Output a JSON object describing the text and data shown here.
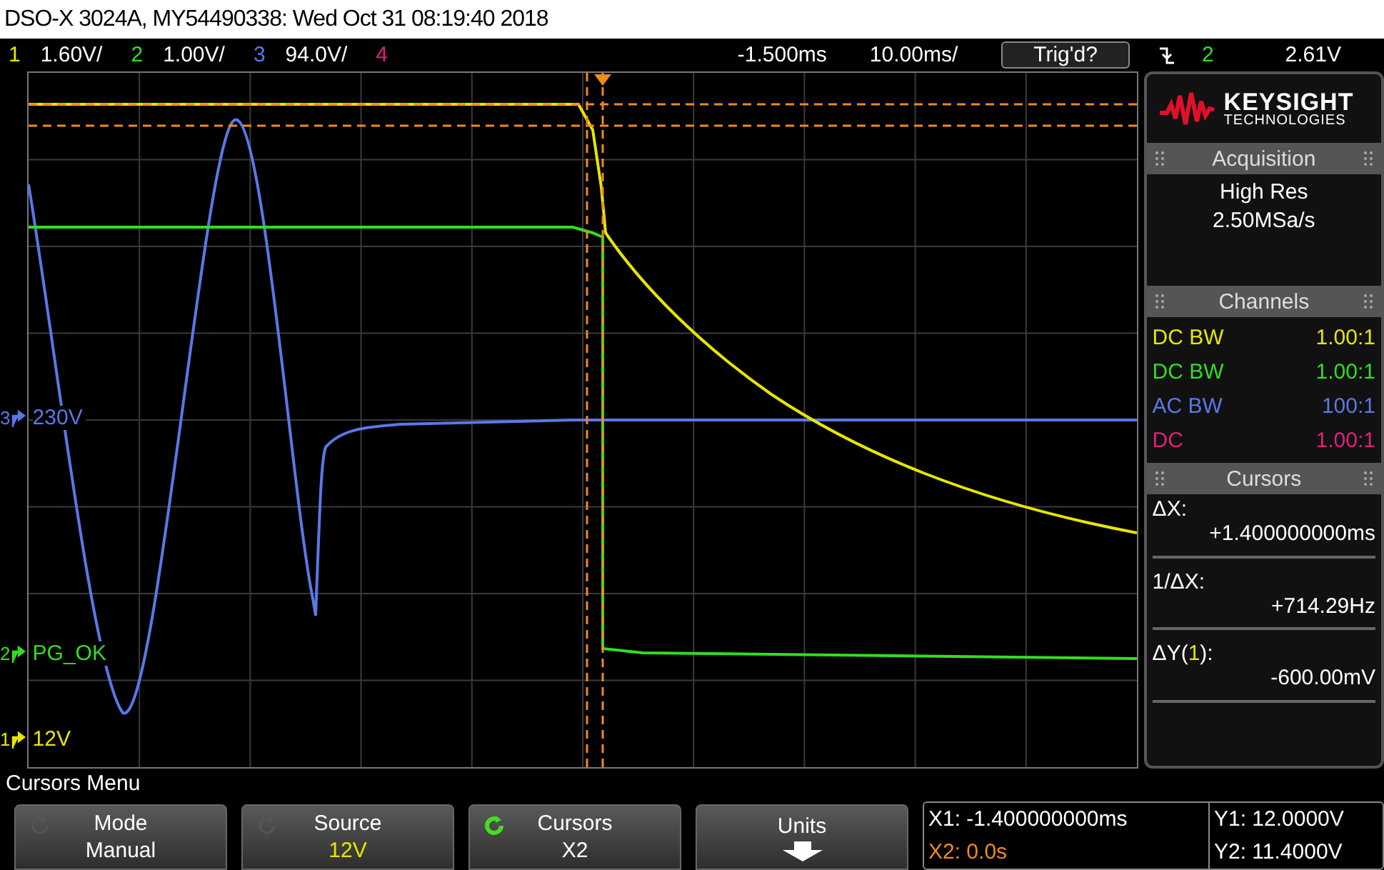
{
  "title_bar": {
    "text": "DSO-X 3024A, MY54490338: Wed Oct 31 08:19:40 2018"
  },
  "channel_bar": {
    "channels": [
      {
        "number": "1",
        "scale": "1.60V/",
        "color": "#e6e600"
      },
      {
        "number": "2",
        "scale": "1.00V/",
        "color": "#33dd22"
      },
      {
        "number": "3",
        "scale": "94.0V/",
        "color": "#5a78e8"
      },
      {
        "number": "4",
        "color": "#e0207a"
      }
    ],
    "delay": "-1.500ms",
    "timebase": "10.00ms/",
    "trigger_status": "Trig'd?",
    "trigger_source": {
      "text": "2",
      "color": "#33dd22"
    },
    "trigger_level": "2.61V"
  },
  "waveform_display": {
    "channel_labels": [
      {
        "number": "3",
        "label": "230V",
        "color": "#5a78e8"
      },
      {
        "number": "2",
        "label": "PG_OK",
        "color": "#33dd22"
      },
      {
        "number": "1",
        "label": "12V",
        "color": "#e6e600"
      }
    ]
  },
  "side_panel": {
    "logo": {
      "name": "KEYSIGHT",
      "tagline": "TECHNOLOGIES"
    },
    "acquisition": {
      "title": "Acquisition",
      "mode": "High Res",
      "sample_rate": "2.50MSa/s"
    },
    "channels": {
      "title": "Channels",
      "items": [
        {
          "coupling": "DC BW",
          "probe": "1.00:1",
          "color": "#e6e600"
        },
        {
          "coupling": "DC BW",
          "probe": "1.00:1",
          "color": "#33dd22"
        },
        {
          "coupling": "AC BW",
          "probe": "100:1",
          "color": "#5a78e8"
        },
        {
          "coupling": "DC",
          "probe": "1.00:1",
          "color": "#e0207a"
        }
      ]
    },
    "cursors": {
      "title": "Cursors",
      "readouts": [
        {
          "quantity": "ΔX:",
          "reading": "+1.400000000ms"
        },
        {
          "quantity": "1/ΔX:",
          "reading": "+714.29Hz"
        },
        {
          "quantity": "ΔY(",
          "channel": {
            "text": "1",
            "color": "#e6e600"
          },
          "quantity_end": "):",
          "reading": "-600.00mV"
        }
      ]
    }
  },
  "menu": {
    "title": "Cursors Menu",
    "softkeys": [
      {
        "kind": "knob",
        "label": "Mode",
        "value": "Manual",
        "active": false,
        "color": "#ffffff"
      },
      {
        "kind": "knob",
        "label": "Source",
        "value": "12V",
        "active": false,
        "color": "#e6e600"
      },
      {
        "kind": "knob",
        "label": "Cursors",
        "value": "X2",
        "active": true,
        "color": "#ffffff"
      },
      {
        "kind": "arrow",
        "label": "Units"
      }
    ],
    "readout_x": [
      {
        "text": "X1: -1.400000000ms",
        "selected": false
      },
      {
        "text": "X2: 0.0s",
        "selected": true
      }
    ],
    "readout_y": [
      {
        "text": "Y1: 12.0000V",
        "selected": false
      },
      {
        "text": "Y2: 11.4000V",
        "selected": false
      }
    ]
  }
}
